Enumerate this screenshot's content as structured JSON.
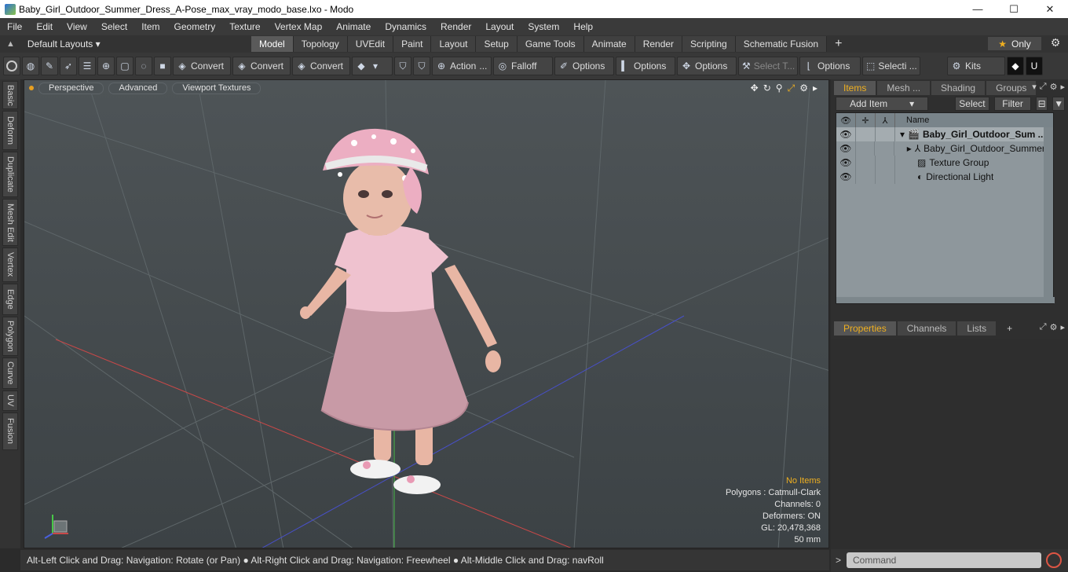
{
  "window": {
    "title": "Baby_Girl_Outdoor_Summer_Dress_A-Pose_max_vray_modo_base.lxo - Modo",
    "minimize": "—",
    "maximize": "☐",
    "close": "✕"
  },
  "menu": [
    "File",
    "Edit",
    "View",
    "Select",
    "Item",
    "Geometry",
    "Texture",
    "Vertex Map",
    "Animate",
    "Dynamics",
    "Render",
    "Layout",
    "System",
    "Help"
  ],
  "layouts": {
    "label": "Default Layouts ▾",
    "tabs": [
      "Model",
      "Topology",
      "UVEdit",
      "Paint",
      "Layout",
      "Setup",
      "Game Tools",
      "Animate",
      "Render",
      "Scripting",
      "Schematic Fusion"
    ],
    "active_tab": "Model",
    "plus": "+",
    "only": "Only",
    "star": "★",
    "gear": "⚙"
  },
  "toolbar": {
    "convert1": "Convert",
    "convert2": "Convert",
    "convert3": "Convert",
    "action": "Action",
    "action_more": "...",
    "falloff": "Falloff",
    "options1": "Options",
    "options2": "Options",
    "options3": "Options",
    "select_t": "Select T...",
    "options4": "Options",
    "selecti": "Selecti ...",
    "kits": "Kits"
  },
  "left_tabs": [
    "Basic",
    "Deform",
    "Duplicate",
    "Mesh Edit",
    "Vertex",
    "Edge",
    "Polygon",
    "Curve",
    "UV",
    "Fusion"
  ],
  "viewport": {
    "perspective": "Perspective",
    "advanced": "Advanced",
    "textures": "Viewport Textures",
    "info": {
      "no_items": "No Items",
      "polygons": "Polygons : Catmull-Clark",
      "channels": "Channels: 0",
      "deformers": "Deformers: ON",
      "gl": "GL: 20,478,368",
      "mm": "50 mm"
    }
  },
  "status": {
    "text": "Alt-Left Click and Drag: Navigation: Rotate (or Pan) ● Alt-Right Click and Drag: Navigation: Freewheel ● Alt-Middle Click and Drag: navRoll"
  },
  "items_panel": {
    "tabs": [
      "Items",
      "Mesh ...",
      "Shading",
      "Groups"
    ],
    "active": "Items",
    "add_item": "Add Item",
    "select": "Select",
    "filter": "Filter",
    "name_header": "Name",
    "rows": [
      {
        "label": "Baby_Girl_Outdoor_Sum ..."
      },
      {
        "label": "Baby_Girl_Outdoor_Summer ..."
      },
      {
        "label": "Texture Group"
      },
      {
        "label": "Directional Light"
      }
    ]
  },
  "props_panel": {
    "tabs": [
      "Properties",
      "Channels",
      "Lists"
    ],
    "plus": "+"
  },
  "command": {
    "placeholder": "Command"
  },
  "colors": {
    "accent": "#f0b020",
    "viewport_bg": "#4a5053"
  }
}
